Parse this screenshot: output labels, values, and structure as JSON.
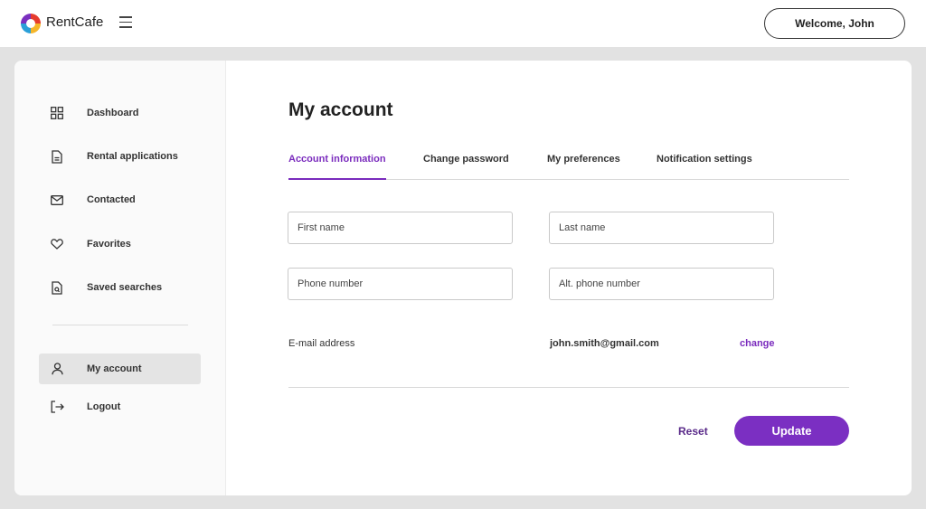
{
  "header": {
    "brand": "RentCafe",
    "welcome": "Welcome, John"
  },
  "sidebar": {
    "items": [
      {
        "label": "Dashboard",
        "icon": "dashboard-grid-icon"
      },
      {
        "label": "Rental applications",
        "icon": "document-icon"
      },
      {
        "label": "Contacted",
        "icon": "envelope-icon"
      },
      {
        "label": "Favorites",
        "icon": "heart-icon"
      },
      {
        "label": "Saved searches",
        "icon": "saved-search-icon"
      },
      {
        "label": "My account",
        "icon": "user-icon",
        "active": true
      },
      {
        "label": "Logout",
        "icon": "logout-icon"
      }
    ]
  },
  "main": {
    "title": "My account",
    "tabs": [
      {
        "label": "Account information",
        "active": true
      },
      {
        "label": "Change password"
      },
      {
        "label": "My preferences"
      },
      {
        "label": "Notification settings"
      }
    ],
    "form": {
      "first_name_placeholder": "First name",
      "last_name_placeholder": "Last name",
      "phone_placeholder": "Phone number",
      "alt_phone_placeholder": "Alt. phone number",
      "first_name_value": "",
      "last_name_value": "",
      "phone_value": "",
      "alt_phone_value": ""
    },
    "email": {
      "label": "E-mail address",
      "value": "john.smith@gmail.com",
      "change_label": "change"
    },
    "actions": {
      "reset_label": "Reset",
      "update_label": "Update"
    }
  },
  "colors": {
    "accent": "#7b2fc2",
    "background": "#e2e2e2",
    "active_nav": "#e4e4e4"
  }
}
